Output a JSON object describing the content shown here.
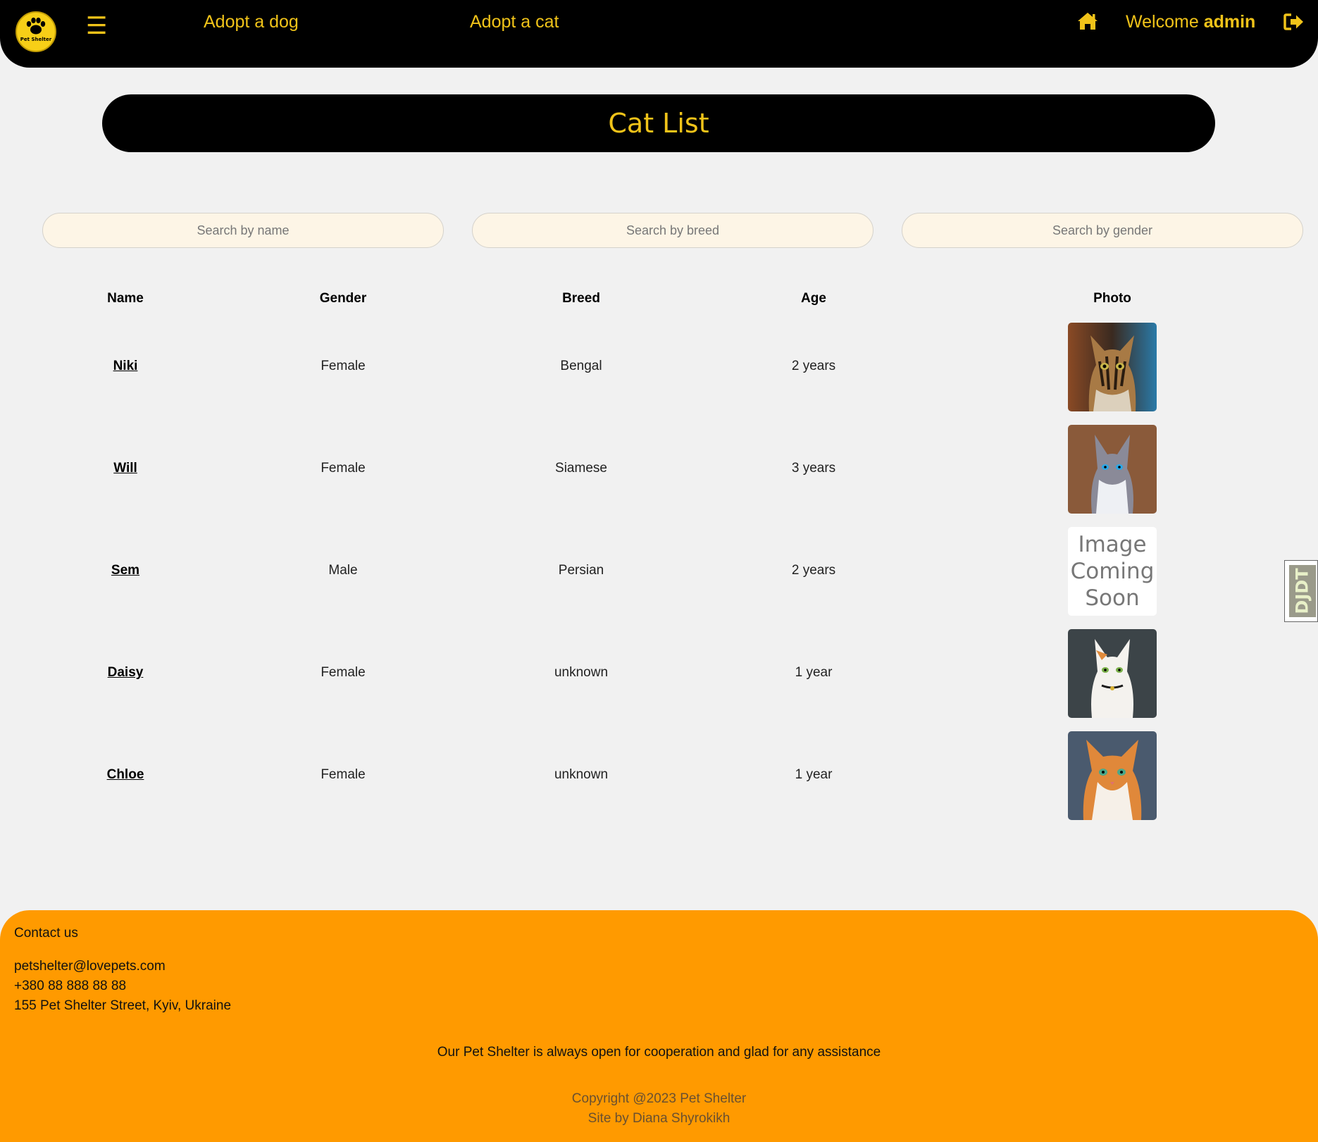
{
  "nav": {
    "logo_text": "Pet Shelter",
    "menu_icon": "☰",
    "links": [
      "Adopt a dog",
      "Adopt a cat"
    ],
    "welcome_prefix": "Welcome",
    "username": "admin"
  },
  "page": {
    "title": "Cat List"
  },
  "search": {
    "name_placeholder": "Search by name",
    "breed_placeholder": "Search by breed",
    "gender_placeholder": "Search by gender"
  },
  "table": {
    "headers": [
      "Name",
      "Gender",
      "Breed",
      "Age",
      "Photo"
    ],
    "rows": [
      {
        "name": "Niki",
        "gender": "Female",
        "breed": "Bengal",
        "age": "2 years",
        "photo": "tabby-cat-photo"
      },
      {
        "name": "Will",
        "gender": "Female",
        "breed": "Siamese",
        "age": "3 years",
        "photo": "gray-blue-eyed-cat-photo"
      },
      {
        "name": "Sem",
        "gender": "Male",
        "breed": "Persian",
        "age": "2 years",
        "photo": "image-coming-soon"
      },
      {
        "name": "Daisy",
        "gender": "Female",
        "breed": "unknown",
        "age": "1 year",
        "photo": "white-cat-photo"
      },
      {
        "name": "Chloe",
        "gender": "Female",
        "breed": "unknown",
        "age": "1 year",
        "photo": "orange-white-cat-photo"
      }
    ],
    "placeholder_image_text": [
      "Image",
      "Coming",
      "Soon"
    ]
  },
  "side_tab": {
    "text": "DJDT"
  },
  "footer": {
    "contact_heading": "Contact us",
    "email": "petshelter@lovepets.com",
    "phone": "+380 88 888 88 88",
    "address": "155 Pet Shelter Street, Kyiv, Ukraine",
    "tagline": "Our Pet Shelter is always open for cooperation and glad for any assistance",
    "copyright": "Copyright @2023 Pet Shelter",
    "credit": "Site by Diana Shyrokikh"
  },
  "colors": {
    "nav_bg": "#000000",
    "accent": "#f0c319",
    "footer_bg": "#ff9a00",
    "page_bg": "#f1f1f1",
    "search_bg": "#fdf5e6"
  }
}
